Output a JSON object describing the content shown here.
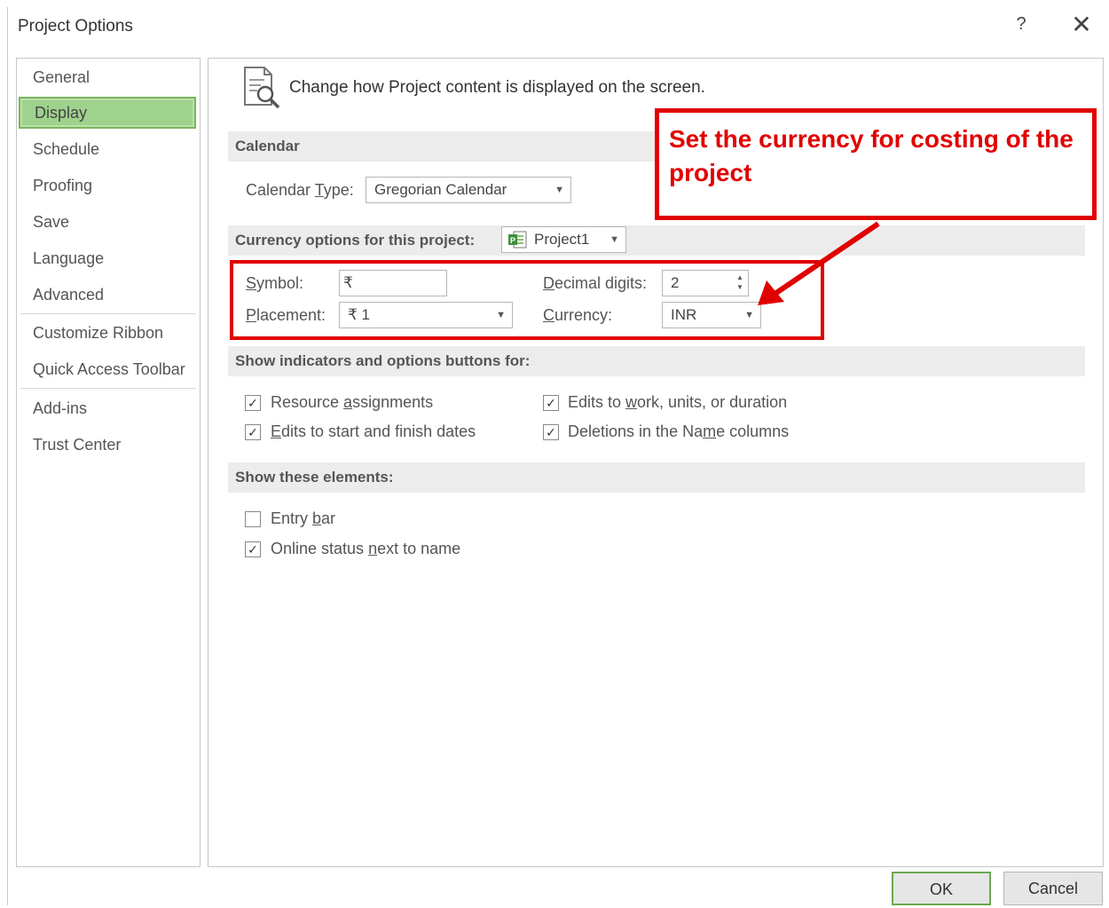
{
  "window": {
    "title": "Project Options",
    "help_label": "?",
    "close_label": "✕"
  },
  "sidebar": {
    "items": [
      {
        "label": "General"
      },
      {
        "label": "Display"
      },
      {
        "label": "Schedule"
      },
      {
        "label": "Proofing"
      },
      {
        "label": "Save"
      },
      {
        "label": "Language"
      },
      {
        "label": "Advanced"
      },
      {
        "label": "Customize Ribbon"
      },
      {
        "label": "Quick Access Toolbar"
      },
      {
        "label": "Add-ins"
      },
      {
        "label": "Trust Center"
      }
    ],
    "selected": "Display"
  },
  "main": {
    "header_text": "Change how Project content is displayed on the screen.",
    "calendar": {
      "section_title": "Calendar",
      "type_label": "Calendar Type:",
      "type_value": "Gregorian Calendar"
    },
    "currency": {
      "section_title": "Currency options for this project:",
      "project_value": "Project1",
      "symbol_label": "Symbol:",
      "symbol_value": "₹",
      "placement_label": "Placement:",
      "placement_value": "₹ 1",
      "decimal_label": "Decimal digits:",
      "decimal_value": "2",
      "currency_label": "Currency:",
      "currency_value": "INR"
    },
    "indicators": {
      "section_title": "Show indicators and options buttons for:",
      "options": [
        {
          "label": "Resource assignments",
          "checked": true
        },
        {
          "label": "Edits to start and finish dates",
          "checked": true
        },
        {
          "label": "Edits to work, units, or duration",
          "checked": true
        },
        {
          "label": "Deletions in the Name columns",
          "checked": true
        }
      ]
    },
    "elements": {
      "section_title": "Show these elements:",
      "options": [
        {
          "label": "Entry bar",
          "checked": false
        },
        {
          "label": "Online status next to name",
          "checked": true
        }
      ]
    }
  },
  "annotation": {
    "text": "Set the currency for costing of the project",
    "color": "#e10000"
  },
  "footer": {
    "ok_label": "OK",
    "cancel_label": "Cancel"
  },
  "colors": {
    "selected_nav": "#9fd28c",
    "section_bar": "#ececec",
    "annotation_red": "#e10000"
  },
  "icons": {
    "header_icon": "document-magnifier-icon",
    "project_icon": "project-file-icon",
    "checkmark": "✓",
    "dropdown_arrow": "▼"
  }
}
